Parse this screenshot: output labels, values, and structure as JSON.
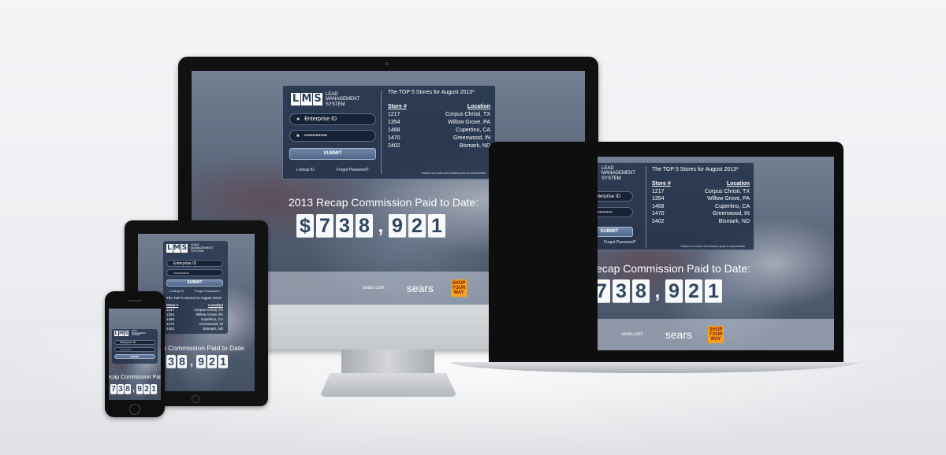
{
  "logo": {
    "letters": [
      "L",
      "M",
      "S"
    ],
    "tagline": "LEAD MANAGEMENT SYSTEM"
  },
  "login": {
    "enterprise_id_placeholder": "Enterprise ID",
    "password_mask": "••••••••••••••",
    "submit_label": "SUBMIT",
    "lookup_label": "Lookup ID",
    "forgot_label": "Forgot Password?"
  },
  "top_stores": {
    "title": "The TOP 5 Stores for August 2013*",
    "col_store": "Store #",
    "col_location": "Location",
    "rows": [
      {
        "store": "1217",
        "location": "Corpus Christi, TX"
      },
      {
        "store": "1354",
        "location": "Willow Grove, PA"
      },
      {
        "store": "1468",
        "location": "Cupertino, CA"
      },
      {
        "store": "1470",
        "location": "Greenwood, IN"
      },
      {
        "store": "2402",
        "location": "Bismark, ND"
      }
    ],
    "footnote": "*based on total commission paid to associates"
  },
  "recap": {
    "caption": "2013 Recap Commission Paid to Date:",
    "caption_cropped": "ecap Commission Paid to Date:",
    "digits": [
      "$",
      "7",
      "3",
      "8",
      ",",
      "9",
      "2",
      "1"
    ],
    "digits_cropped": [
      "7",
      "3",
      "8",
      ",",
      "9",
      "2",
      "1"
    ]
  },
  "footer": {
    "brand1": "sears.com",
    "brand2": "sears",
    "syw_line1": "SHOP",
    "syw_line2": "YOUR",
    "syw_line3": "WAY"
  },
  "colors": {
    "panel": "#1e2d46",
    "accent_button": "#5a7296",
    "digit_text": "#2f4663",
    "syw_orange": "#f6a21a"
  }
}
